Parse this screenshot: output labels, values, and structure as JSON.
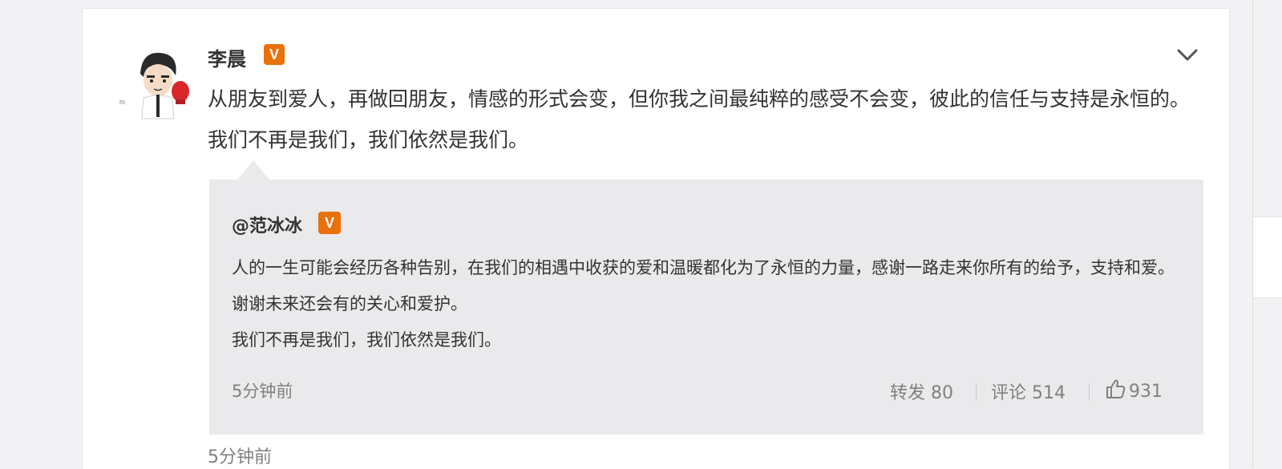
{
  "post": {
    "author": "李晨",
    "verified_badge": "V",
    "text": "从朋友到爱人，再做回朋友，情感的形式会变，但你我之间最纯粹的感受不会变，彼此的信任与支持是永恒的。我们不再是我们，我们依然是我们。",
    "time": "5分钟前"
  },
  "quote": {
    "author": "@范冰冰",
    "verified_badge": "V",
    "text_line1": "人的一生可能会经历各种告别，在我们的相遇中收获的爱和温暖都化为了永恒的力量，感谢一路走来你所有的给予，支持和爱。谢谢未来还会有的关心和爱护。",
    "text_line2": "我们不再是我们，我们依然是我们。",
    "time": "5分钟前",
    "repost_label": "转发 80",
    "comment_label": "评论 514",
    "like_count": "931"
  },
  "colors": {
    "badge": "#e8710a",
    "quote_bg": "#eaeaec",
    "meta_text": "#808080"
  },
  "icons": [
    "chevron-down-icon",
    "thumbs-up-icon",
    "verified-badge-icon"
  ]
}
